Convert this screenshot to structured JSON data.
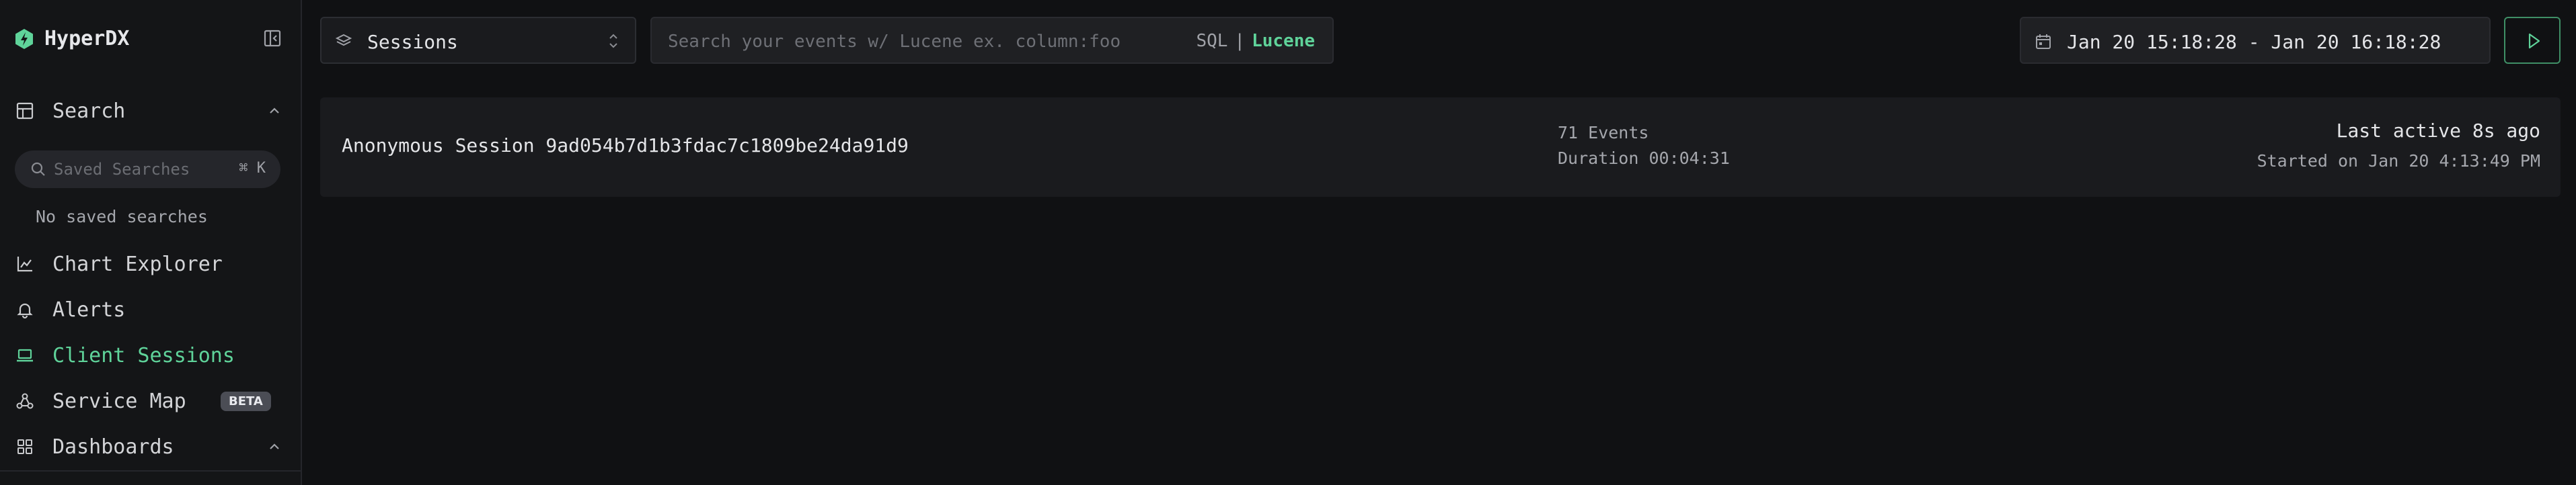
{
  "app": {
    "name": "HyperDX"
  },
  "colors": {
    "accent": "#5fd39a",
    "background": "#101113",
    "sidebar": "#141517",
    "card": "#1a1b1e"
  },
  "sidebar": {
    "search": {
      "label": "Search",
      "icon": "table-icon"
    },
    "saved_searches": {
      "placeholder": "Saved Searches",
      "shortcut": "⌘ K",
      "empty_text": "No saved searches"
    },
    "items": [
      {
        "label": "Chart Explorer",
        "icon": "chart-line-icon"
      },
      {
        "label": "Alerts",
        "icon": "bell-icon"
      },
      {
        "label": "Client Sessions",
        "icon": "laptop-icon",
        "active": true
      },
      {
        "label": "Service Map",
        "icon": "graph-icon",
        "badge": "BETA"
      },
      {
        "label": "Dashboards",
        "icon": "grid-icon"
      }
    ]
  },
  "toolbar": {
    "source": "Sessions",
    "search_placeholder": "Search your events w/ Lucene ex. column:foo",
    "lang_sql": "SQL",
    "lang_sep": "|",
    "lang_lucene": "Lucene",
    "date_range": "Jan 20 15:18:28 - Jan 20 16:18:28"
  },
  "sessions": [
    {
      "name": "Anonymous Session 9ad054b7d1b3fdac7c1809be24da91d9",
      "events": "71 Events",
      "duration": "Duration 00:04:31",
      "last_active": "Last active 8s ago",
      "started": "Started on Jan 20 4:13:49 PM"
    }
  ]
}
